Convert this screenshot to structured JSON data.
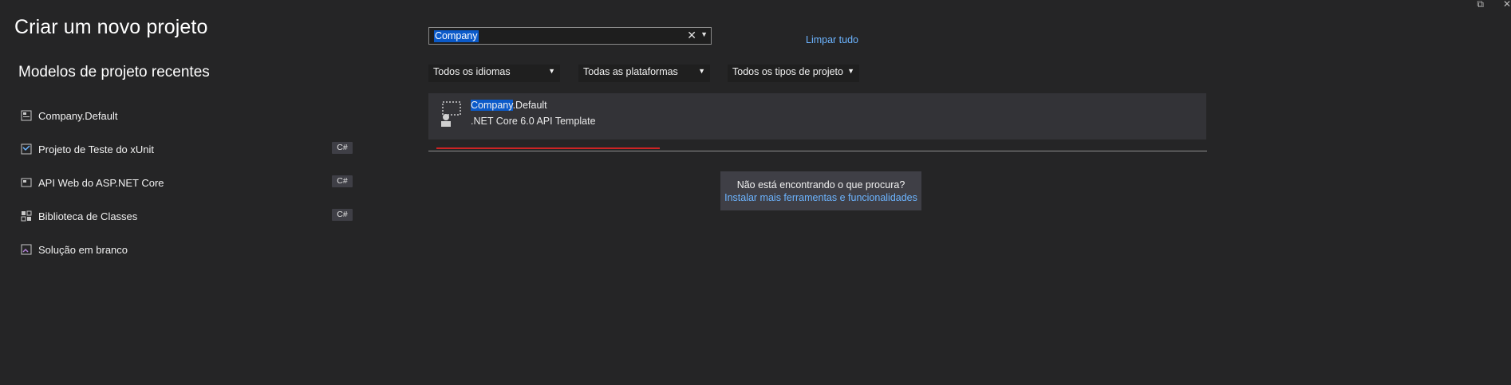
{
  "header": {
    "title": "Criar um novo projeto",
    "recent_title": "Modelos de projeto recentes"
  },
  "recent": [
    {
      "label": "Company.Default",
      "lang": "",
      "icon": "web-api-icon"
    },
    {
      "label": "Projeto de Teste do xUnit",
      "lang": "C#",
      "icon": "test-project-icon"
    },
    {
      "label": "API Web do ASP.NET Core",
      "lang": "C#",
      "icon": "web-api-icon"
    },
    {
      "label": "Biblioteca de Classes",
      "lang": "C#",
      "icon": "class-library-icon"
    },
    {
      "label": "Solução em branco",
      "lang": "",
      "icon": "blank-solution-icon"
    }
  ],
  "search": {
    "value": "Company",
    "clear_glyph": "✕",
    "clear_all_label": "Limpar tudo"
  },
  "filters": {
    "language": "Todos os idiomas",
    "platform": "Todas as plataformas",
    "project_type": "Todos os tipos de projeto"
  },
  "result": {
    "name_highlight": "Company",
    "name_rest": ".Default",
    "description": ".NET Core 6.0 API Template"
  },
  "not_found": {
    "question": "Não está encontrando o que procura?",
    "link": "Instalar mais ferramentas e funcionalidades"
  },
  "colors": {
    "background": "#252526",
    "accent_link": "#6cb4ff",
    "highlight": "#0b5ac9",
    "progress_red": "#cc2424"
  }
}
